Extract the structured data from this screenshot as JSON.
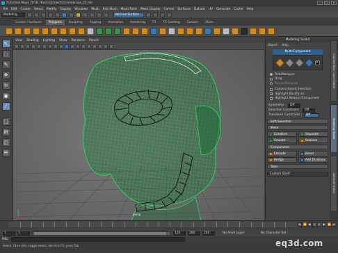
{
  "window": {
    "title": "Autodesk Maya 2016: /Basics/projects/scenes/Lips_02.mb",
    "min": "–",
    "max": "□",
    "close": "✕"
  },
  "menubar": [
    "File",
    "Edit",
    "Create",
    "Select",
    "Modify",
    "Display",
    "Windows",
    "Mesh",
    "Edit Mesh",
    "Mesh Tools",
    "Mesh Display",
    "Curves",
    "Surfaces",
    "Deform",
    "UV",
    "Generate",
    "Cache",
    "Help"
  ],
  "statusline": {
    "mode": "Modeling",
    "live_surface": "No Live Surface"
  },
  "shelf_tabs": [
    "Curves / Surfaces",
    "Polygons",
    "Sculpting",
    "Rigging",
    "Animation",
    "Rendering",
    "FX",
    "FX Caching",
    "Custom",
    "XGen"
  ],
  "shelf_active": "Polygons",
  "viewport": {
    "menu": [
      "View",
      "Shading",
      "Lighting",
      "Show",
      "Renderer",
      "Panels"
    ],
    "camera_label": "persp"
  },
  "modeling_toolkit": {
    "title": "Modeling Toolkit",
    "menu": [
      "Object",
      "Help"
    ],
    "header": "Multi-Component",
    "close_glyph": "✕",
    "selection_modes": [
      {
        "label": "Pick/Marquee",
        "selected": true
      },
      {
        "label": "Drag",
        "selected": false
      },
      {
        "label": "Tweak/Marquee",
        "selected": false
      }
    ],
    "options": [
      {
        "label": "Camera Based Selection",
        "checked": false
      },
      {
        "label": "Highlight Backfaces",
        "checked": true
      },
      {
        "label": "Highlight Nearest Component",
        "checked": true
      }
    ],
    "symmetry_label": "Symmetry :",
    "symmetry_value": "Off",
    "constraint_label": "Selection Constraint :",
    "constraint_value": "Off",
    "transform_label": "Transform Constraint :",
    "transform_value": "Off",
    "soft_selection": "Soft Selection",
    "mesh_section": "Mesh",
    "mesh_buttons": [
      "Combine",
      "Separate",
      "Smooth",
      "Boolean"
    ],
    "components_section": "Components",
    "component_buttons": [
      "Extrude",
      "Bevel",
      "Bridge",
      "Add Divisions"
    ],
    "tools_section": "Tools",
    "attr_field": "Custom Shelf"
  },
  "side_tabs": [
    "Channel Box / Layer Editor",
    "Modeling Toolkit",
    "Attribute Editor"
  ],
  "side_tab_active": "Modeling Toolkit",
  "timeline": {
    "ticks": [
      "5",
      "10",
      "15",
      "20",
      "25",
      "30",
      "35",
      "40",
      "45",
      "50",
      "55",
      "60",
      "65",
      "70",
      "75",
      "80",
      "85",
      "90",
      "95",
      "100",
      "105",
      "110",
      "115",
      "120"
    ],
    "range_start": "1",
    "range_inner_start": "1",
    "range_inner_end": "120",
    "range_end": "120",
    "anim_end": "200",
    "anim_end2": "200",
    "no_anim_layer": "No Anim Layer",
    "no_char_set": "No Character Set",
    "current_frame": "1"
  },
  "mel_label": "MEL",
  "help_line": "Select: Ctrl+click, toggle select, dbl-click F2, press Tab",
  "watermark": "eq3d.com",
  "colors": {
    "wireframe": "#2fd35c",
    "highlight": "#1b1b1b",
    "selection_blue": "#3b6f9e",
    "shelf_orange": "#d48a1e"
  }
}
